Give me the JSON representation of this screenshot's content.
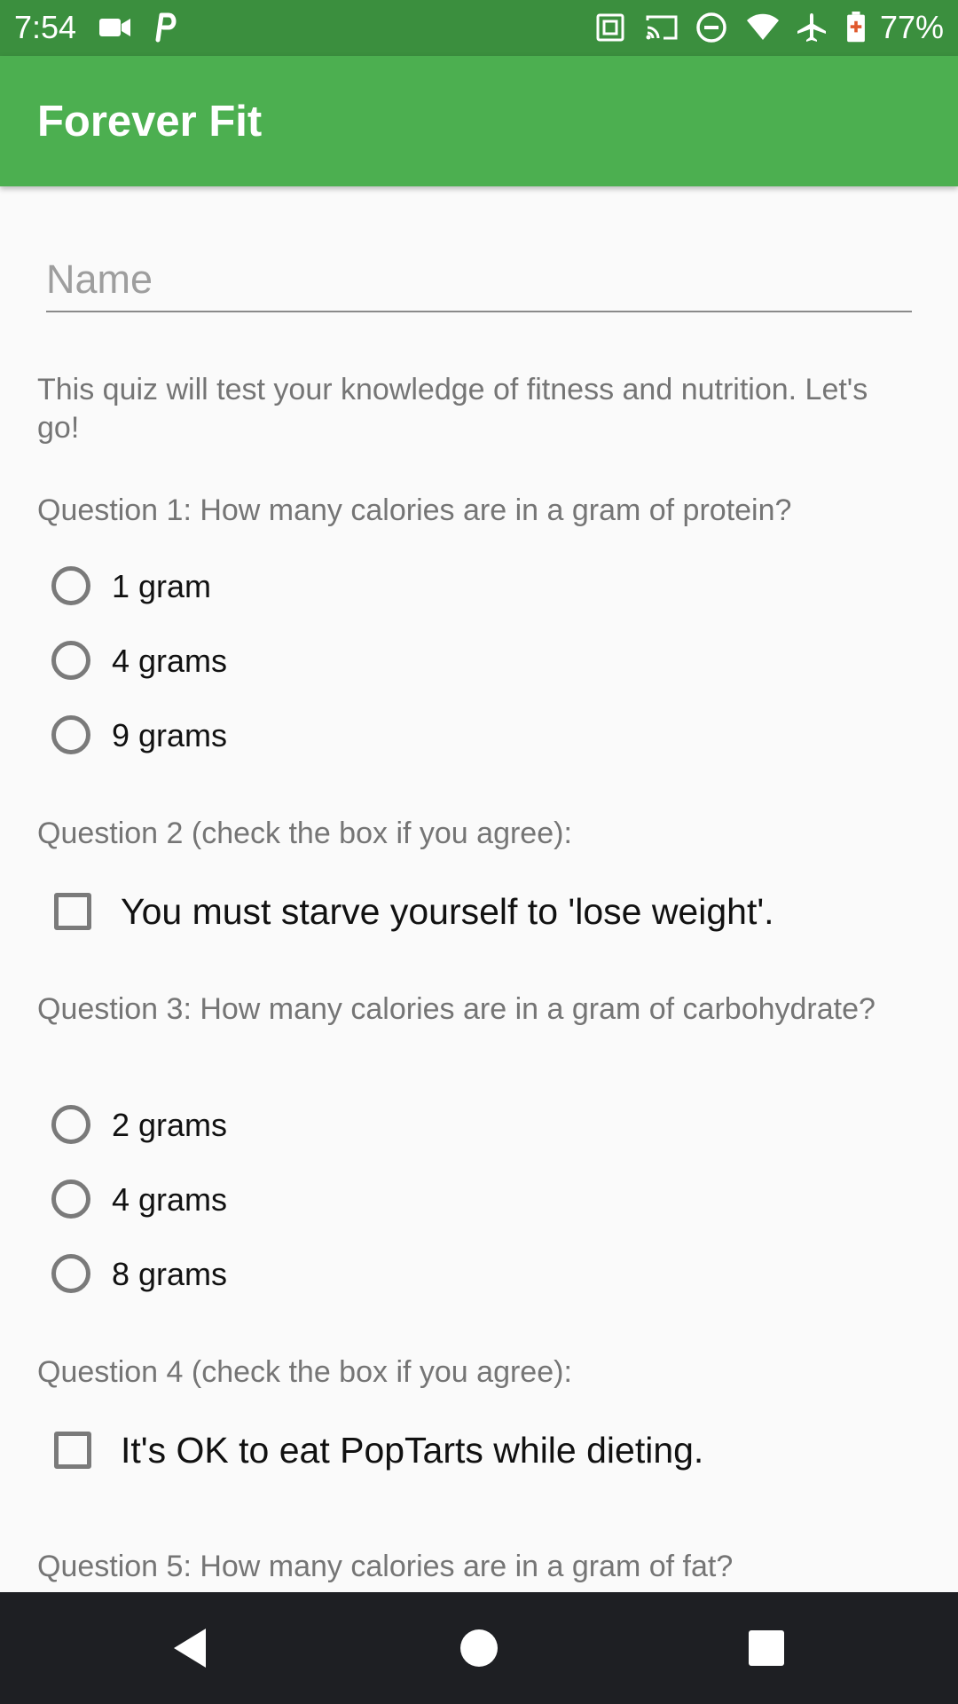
{
  "status_bar": {
    "time": "7:54",
    "battery_percent": "77%",
    "icons": [
      "video-camera-icon",
      "parking-icon",
      "nfc-icon",
      "cast-icon",
      "do-not-disturb-icon",
      "wifi-icon",
      "airplane-mode-icon",
      "battery-icon"
    ],
    "background": "#3b8f3e"
  },
  "app_bar": {
    "title": "Forever Fit",
    "color": "#4caf50"
  },
  "form": {
    "name_placeholder": "Name",
    "name_value": "",
    "intro": "This quiz will test your knowledge of fitness and nutrition. Let's go!",
    "q1": {
      "text": "Question 1: How many calories are in a gram of protein?",
      "options": [
        "1 gram",
        "4 grams",
        "9 grams"
      ],
      "selected": null
    },
    "q2": {
      "text": "Question 2 (check the box if you agree):",
      "statement": "You must starve yourself to 'lose weight'.",
      "checked": false
    },
    "q3": {
      "text": "Question 3: How many calories are in a gram of carbohydrate?",
      "options": [
        "2 grams",
        "4 grams",
        "8 grams"
      ],
      "selected": null
    },
    "q4": {
      "text": "Question 4 (check the box if you agree):",
      "statement": "It's OK to eat PopTarts while dieting.",
      "checked": false
    },
    "q5": {
      "text": "Question 5: How many calories are in a gram of fat?"
    }
  },
  "nav_bar": {
    "buttons": [
      "back-icon",
      "home-icon",
      "recents-icon"
    ]
  }
}
